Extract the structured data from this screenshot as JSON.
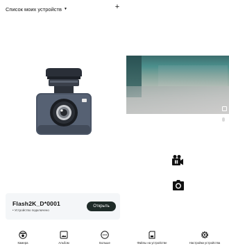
{
  "header": {
    "title": "Список моих устройств",
    "caret": "▼",
    "add": "+"
  },
  "preview": {
    "timestamp": "                "
  },
  "device": {
    "name": "Flash2K_D*0001",
    "status": "• Устройство подключено",
    "open_label": "Открыть"
  },
  "nav": {
    "camera": "Камера",
    "album": "Альбом",
    "more": "Больше",
    "files": "Файлы на устройстве",
    "settings": "Настройки устройства"
  },
  "colors": {
    "accent_button": "#1f2b28",
    "card_bg": "#f4f6f8",
    "camera_body": "#4b5566",
    "camera_mount": "#262b33"
  },
  "icons": {
    "record": "video-camera-pause-icon",
    "snapshot": "camera-icon",
    "camera_tab": "camera-icon",
    "album_tab": "image-icon",
    "more_tab": "more-dots-icon",
    "files_tab": "sd-card-icon",
    "settings_tab": "gear-icon"
  }
}
